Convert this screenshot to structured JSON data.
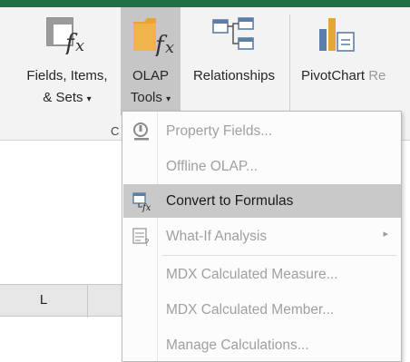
{
  "ribbon": {
    "fields_items_sets": {
      "line1": "Fields, Items,",
      "line2": "& Sets",
      "arrow": "▾"
    },
    "olap_tools": {
      "line1": "OLAP",
      "line2": "Tools",
      "arrow": "▾"
    },
    "relationships": {
      "label": "Relationships"
    },
    "pivotchart": {
      "label": "PivotChart",
      "clipped": "Re"
    },
    "group_letter": "C"
  },
  "sheet": {
    "column_letter": "L"
  },
  "menu": {
    "items": [
      {
        "label": "Property Fields...",
        "enabled": false,
        "icon": "property-fields-icon"
      },
      {
        "label": "Offline OLAP...",
        "enabled": false,
        "icon": ""
      },
      {
        "label": "Convert to Formulas",
        "enabled": true,
        "highlighted": true,
        "icon": "convert-to-formulas-icon"
      },
      {
        "label": "What-If Analysis",
        "enabled": false,
        "icon": "what-if-analysis-icon",
        "submenu_arrow": "▸"
      },
      {
        "label": "MDX Calculated Measure...",
        "enabled": false,
        "icon": ""
      },
      {
        "label": "MDX Calculated Member...",
        "enabled": false,
        "icon": ""
      },
      {
        "label": "Manage Calculations...",
        "enabled": false,
        "icon": ""
      }
    ]
  },
  "colors": {
    "excel_green": "#1e7145",
    "highlight": "#c9c9c9",
    "disabled_text": "#a0a0a0"
  }
}
